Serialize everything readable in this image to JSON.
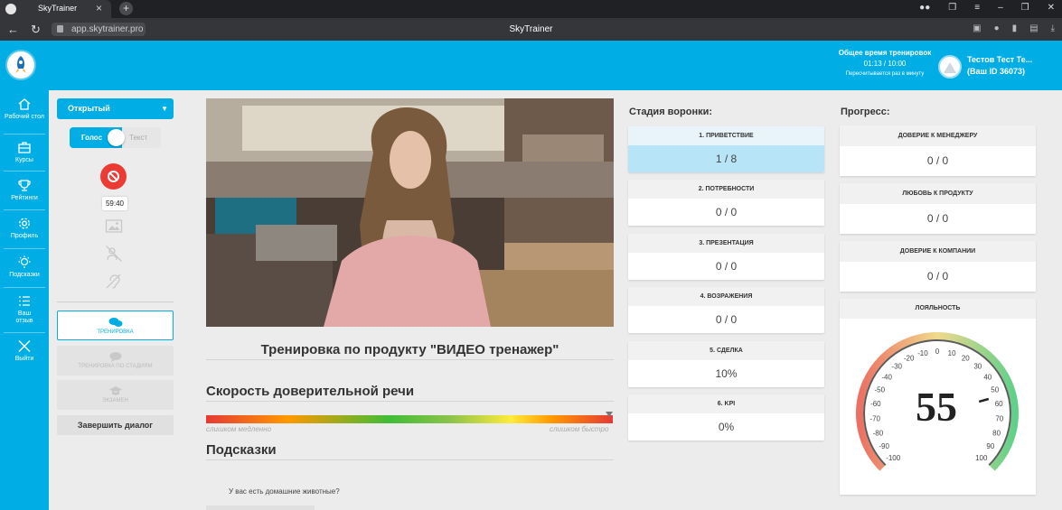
{
  "browser": {
    "tab_title": "SkyTrainer",
    "url": "app.skytrainer.pro",
    "page_title": "SkyTrainer"
  },
  "header": {
    "training_time_label": "Общее время тренировок",
    "training_time_value": "01:13 / 10:00",
    "training_time_note": "Пересчитывается раз в минуту",
    "user_name": "Тестов Тест Те...",
    "user_id": "(Ваш ID 36073)"
  },
  "sidebar": {
    "items": [
      {
        "label": "Рабочий стол",
        "icon": "home-icon"
      },
      {
        "label": "Курсы",
        "icon": "briefcase-icon"
      },
      {
        "label": "Рейтинги",
        "icon": "trophy-icon"
      },
      {
        "label": "Профиль",
        "icon": "gear-icon"
      },
      {
        "label": "Подсказки",
        "icon": "lightbulb-icon"
      },
      {
        "label": "Ваш отзыв",
        "icon": "list-icon"
      },
      {
        "label": "Выйти",
        "icon": "close-icon"
      }
    ]
  },
  "controls": {
    "mode_select": "Открытый",
    "toggle_on": "Голос",
    "toggle_off": "Текст",
    "timer": "59:40",
    "mode_buttons": [
      {
        "label": "ТРЕНИРОВКА",
        "icon": "chat-bubbles-icon"
      },
      {
        "label": "ТРЕНИРОВКА ПО СТАДИЯМ",
        "icon": "chat-bubble-icon"
      },
      {
        "label": "ЭКЗАМЕН",
        "icon": "graduation-cap-icon"
      }
    ],
    "end_dialog": "Завершить диалог"
  },
  "main": {
    "training_title": "Тренировка по продукту \"ВИДЕО тренажер\"",
    "speech_speed_title": "Скорость доверительной речи",
    "speed_slow": "слишком медленно",
    "speed_fast": "слишком быстро",
    "speed_position": 0.99,
    "hints_title": "Подсказки",
    "hint_text": "У вас есть домашние животные?"
  },
  "funnel": {
    "title": "Стадия воронки:",
    "stages": [
      {
        "name": "1. ПРИВЕТСТВИЕ",
        "value": "1 / 8",
        "active": true
      },
      {
        "name": "2. ПОТРЕБНОСТИ",
        "value": "0 / 0"
      },
      {
        "name": "3. ПРЕЗЕНТАЦИЯ",
        "value": "0 / 0"
      },
      {
        "name": "4. ВОЗРАЖЕНИЯ",
        "value": "0 / 0"
      },
      {
        "name": "5. СДЕЛКА",
        "value": "10%"
      },
      {
        "name": "6. KPI",
        "value": "0%"
      }
    ]
  },
  "progress": {
    "title": "Прогресс:",
    "items": [
      {
        "name": "ДОВЕРИЕ К МЕНЕДЖЕРУ",
        "value": "0 / 0"
      },
      {
        "name": "ЛЮБОВЬ К ПРОДУКТУ",
        "value": "0 / 0"
      },
      {
        "name": "ДОВЕРИЕ К КОМПАНИИ",
        "value": "0 / 0"
      }
    ],
    "loyalty": {
      "title": "ЛОЯЛЬНОСТЬ",
      "value": 55,
      "value_text": "55",
      "ticks": [
        "-100",
        "-90",
        "-80",
        "-70",
        "-60",
        "-50",
        "-40",
        "-30",
        "-20",
        "-10",
        "0",
        "10",
        "20",
        "30",
        "40",
        "50",
        "60",
        "70",
        "80",
        "90",
        "100"
      ]
    }
  },
  "colors": {
    "brand": "#00aee5",
    "stop": "#ec3b35",
    "active_stage": "#b7e4f6"
  }
}
